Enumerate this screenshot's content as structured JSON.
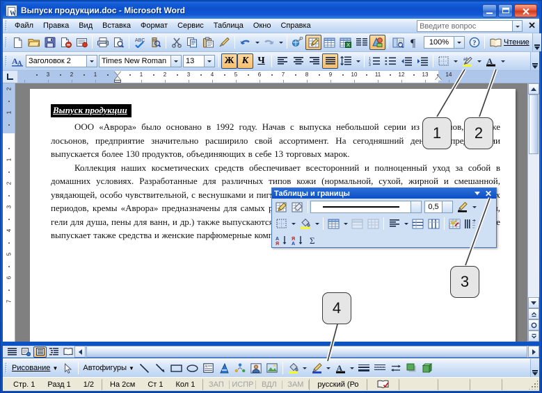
{
  "window": {
    "title": "Выпуск продукции.doc - Microsoft Word",
    "icon": "word-document-icon",
    "minimize": "–",
    "maximize": "□",
    "close": "✕"
  },
  "menubar": {
    "items": [
      "Файл",
      "Правка",
      "Вид",
      "Вставка",
      "Формат",
      "Сервис",
      "Таблица",
      "Окно",
      "Справка"
    ],
    "ask_placeholder": "Введите вопрос",
    "ask_value": "",
    "close_label": "✕"
  },
  "standard_toolbar": {
    "buttons": [
      "new-document-icon",
      "open-folder-icon",
      "save-disk-icon",
      "mail-recipient-icon",
      "permission-icon",
      "print-icon",
      "print-preview-icon",
      "spelling-check-icon",
      "research-icon",
      "cut-scissors-icon",
      "copy-icon",
      "paste-icon",
      "format-painter-icon",
      "undo-icon",
      "redo-icon",
      "insert-hyperlink-icon",
      "tables-and-borders-icon",
      "insert-table-icon",
      "insert-excel-sheet-icon",
      "columns-icon",
      "drawing-icon",
      "document-map-icon",
      "show-formatting-marks-icon"
    ],
    "zoom_value": "100%",
    "help_icon": "help-question-icon",
    "reading_label": "Чтение",
    "reading_icon": "reading-layout-icon",
    "pressed": [
      "tables-and-borders-icon",
      "drawing-icon"
    ]
  },
  "formatting_toolbar": {
    "styles_icon": "styles-and-formatting-icon",
    "style_value": "Заголовок 2",
    "font_value": "Times New Roman",
    "size_value": "13",
    "bold_label": "Ж",
    "italic_label": "К",
    "underline_label": "Ч",
    "align_left": "align-left-icon",
    "align_center": "align-center-icon",
    "align_right": "align-right-icon",
    "align_justify": "align-justify-icon",
    "line_spacing": "line-spacing-icon",
    "numbering": "numbered-list-icon",
    "bullets": "bulleted-list-icon",
    "decrease_indent": "decrease-indent-icon",
    "increase_indent": "increase-indent-icon",
    "borders": "outside-border-icon",
    "highlight": "highlight-color-icon",
    "font_color": "font-color-icon",
    "pressed": [
      "bold",
      "italic",
      "align-justify"
    ]
  },
  "ruler": {
    "horizontal_labels": [
      "3",
      "2",
      "1",
      "1",
      "2",
      "3",
      "4",
      "5",
      "6",
      "7",
      "8",
      "9",
      "10",
      "11",
      "12",
      "13",
      "14"
    ],
    "vertical_labels": [
      "2",
      "1",
      "1",
      "2",
      "3",
      "4",
      "5",
      "6",
      "7"
    ],
    "tab_stop_icon": "left-tab-stop-icon"
  },
  "document": {
    "heading": "Выпуск продукции",
    "paragraphs": [
      "ООО «Аврора» было основано в 1992 году. Начав с выпуска небольшой серии из 8 кремов, а также лосьонов, предприятие значительно расширило свой ассортимент. На сегодняшний день на предприятии выпускается более 130 продуктов, объединяющих в себе 13 торговых марок.",
      "Коллекция наших косметических средств обеспечивает всесторонний и полноценный уход за собой в домашних условиях. Разработанные для различных типов кожи (нормальной, сухой, жирной и смешанной, увядающей, особо чувствительной, с веснушками и пигментными пятнами, и др.), а также для разных возрастных периодов, кремы «Аврора» предназначены для самых разных групп потребителей. Моющие средства (шампуни, гели для душа, пены для ванн, и др.) также выпускаются с учетом многообразия типов волос и кожи. Предприятие выпускает также средства и женские парфюмерные композиции для себя, для дома"
    ]
  },
  "tables_borders_toolbar": {
    "title": "Таблицы и границы",
    "dropdown_icon": "chevron-down-icon",
    "close_icon": "close-icon",
    "row1": {
      "draw_table": "draw-table-pencil-icon",
      "eraser": "eraser-icon",
      "line_style_value": "line-style-solid",
      "line_weight_value": "0,5",
      "border_color": "border-color-pencil-icon"
    },
    "row2": [
      "outside-border-icon",
      "shading-color-icon",
      "insert-table-icon",
      "merge-cells-icon",
      "split-cells-icon",
      "align-cell-icon",
      "distribute-rows-evenly-icon",
      "distribute-columns-evenly-icon",
      "table-autoformat-icon",
      "change-text-direction-icon"
    ],
    "row3": [
      "sort-ascending-icon",
      "sort-descending-icon",
      "autosum-icon"
    ]
  },
  "callouts": [
    {
      "number": "1"
    },
    {
      "number": "2"
    },
    {
      "number": "3"
    },
    {
      "number": "4"
    }
  ],
  "view_buttons": {
    "items": [
      "normal-view-icon",
      "web-layout-view-icon",
      "print-layout-view-icon",
      "outline-view-icon",
      "reading-layout-view-icon"
    ],
    "active": "print-layout-view-icon"
  },
  "drawing_toolbar": {
    "menu_label": "Рисование",
    "select_icon": "select-objects-arrow-icon",
    "autoshapes_label": "Автофигуры",
    "buttons": [
      "line-icon",
      "arrow-icon",
      "rectangle-icon",
      "oval-icon",
      "text-box-icon",
      "wordart-icon",
      "diagram-icon",
      "clip-art-icon",
      "picture-icon",
      "fill-color-icon",
      "line-color-icon",
      "font-color-icon",
      "line-style-icon",
      "dash-style-icon",
      "arrow-style-icon",
      "shadow-style-icon",
      "3d-style-icon"
    ]
  },
  "statusbar": {
    "page_label": "Стр.",
    "page_value": "1",
    "section_label": "Разд",
    "section_value": "1",
    "pages_value": "1/2",
    "at_label": "На",
    "at_value": "2см",
    "line_label": "Ст",
    "line_value": "1",
    "col_label": "Кол",
    "col_value": "1",
    "modes": [
      "ЗАП",
      "ИСПР",
      "ВДЛ",
      "ЗАМ"
    ],
    "language": "русский (Ро",
    "spell_icon": "spelling-status-icon"
  },
  "colors": {
    "titlebar_blue": "#0c4fcd",
    "toolbar_blue": "#c8dcf5",
    "status_beige": "#ece9d8",
    "accent_orange": "#f7bf6e",
    "desktop_gray": "#808080"
  }
}
